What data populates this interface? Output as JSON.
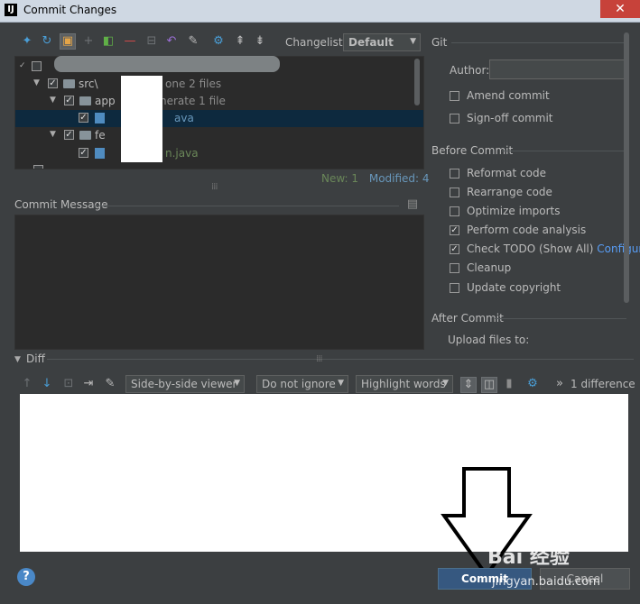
{
  "window": {
    "title": "Commit Changes",
    "app_icon": "IJ",
    "close_glyph": "✕"
  },
  "toolbar": {
    "icons": [
      "refresh-arrows-icon",
      "sync-icon",
      "shelve-icon",
      "plus-icon",
      "vcs-icon",
      "minus-icon",
      "diff-icon",
      "revert-icon",
      "edit-icon",
      "gear-icon",
      "expand-all-icon",
      "collapse-all-icon"
    ],
    "changelist_label": "Changelist:",
    "changelist_value": "Default",
    "dropdown_glyph": "▼"
  },
  "tree": {
    "rows": [
      {
        "indent": 0,
        "text": "",
        "kind": "root"
      },
      {
        "indent": 1,
        "text": "src\\",
        "suffix": "one  2 files",
        "kind": "folder"
      },
      {
        "indent": 2,
        "text": "app",
        "suffix": "nerate  1 file",
        "kind": "folder"
      },
      {
        "indent": 3,
        "text": "ava",
        "kind": "file",
        "color": "blue",
        "selected": true
      },
      {
        "indent": 2,
        "text": "fe",
        "kind": "folder"
      },
      {
        "indent": 3,
        "text": "n.java",
        "kind": "file",
        "color": "green"
      }
    ],
    "check_glyph": "✓",
    "expand_glyph": "▼"
  },
  "counts": {
    "new": "New: 1",
    "modified": "Modified: 4"
  },
  "commit_message": {
    "label": "Commit Message"
  },
  "git": {
    "label": "Git",
    "author_label": "Author:",
    "author_value": "",
    "amend_label": "Amend commit",
    "signoff_label": "Sign-off commit"
  },
  "before_commit": {
    "label": "Before Commit",
    "options": [
      {
        "label": "Reformat code",
        "checked": false
      },
      {
        "label": "Rearrange code",
        "checked": false
      },
      {
        "label": "Optimize imports",
        "checked": false
      },
      {
        "label": "Perform code analysis",
        "checked": true
      },
      {
        "label": "Check TODO (Show All)",
        "checked": true,
        "link": "Configure"
      },
      {
        "label": "Cleanup",
        "checked": false
      },
      {
        "label": "Update copyright",
        "checked": false
      }
    ]
  },
  "after_commit": {
    "label": "After Commit",
    "upload_label": "Upload files to:"
  },
  "diff": {
    "label": "Diff",
    "viewer": "Side-by-side viewer",
    "ignore": "Do not ignore",
    "highlight": "Highlight words",
    "count": "1 difference",
    "more_glyph": "»"
  },
  "buttons": {
    "help": "?",
    "commit": "Commit",
    "cancel": "Cancel"
  },
  "watermark": {
    "main": "Bai 经验",
    "sub": "jingyan.baidu.com"
  },
  "colors": {
    "accent": "#365880",
    "link": "#589df6",
    "new": "#6a8759",
    "modified": "#6897bb"
  }
}
